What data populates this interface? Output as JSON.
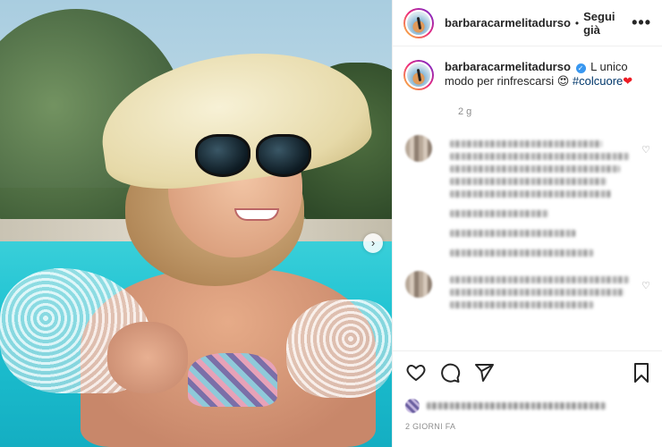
{
  "post": {
    "username": "barbaracarmelitadurso",
    "follow_separator": "•",
    "follow_label": "Segui già",
    "more_label": "•••",
    "next_label": "›"
  },
  "caption": {
    "username": "barbaracarmelitadurso",
    "verified_mark": "✓",
    "text": "L unico modo per rinfrescarsi",
    "emoji": "😍",
    "hashtag": "#colcuore",
    "heart": "❤",
    "time": "2 g"
  },
  "comments": [
    {
      "avatar": "blurred",
      "lines": 5
    },
    {
      "avatar": "blurred",
      "lines": 3
    }
  ],
  "actions": {
    "like": "heart-icon",
    "comment": "comment-icon",
    "share": "share-icon",
    "save": "bookmark-icon"
  },
  "footer": {
    "date": "2 GIORNI FA"
  },
  "colors": {
    "verified": "#3897f0",
    "hashtag": "#00376b",
    "meta": "#8e8e8e",
    "border": "#efefef"
  }
}
